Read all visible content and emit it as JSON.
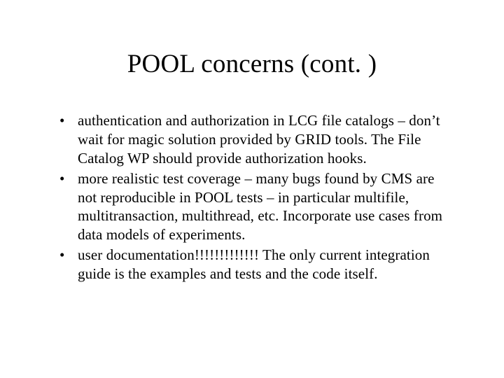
{
  "slide": {
    "title": "POOL concerns (cont. )",
    "bullets": [
      "authentication and authorization in LCG file catalogs – don’t wait for magic solution provided by GRID tools.  The File Catalog WP should provide authorization hooks.",
      "more realistic test coverage – many bugs found by CMS are not reproducible in POOL tests – in particular multifile, multitransaction, multithread, etc.   Incorporate use cases from data models of experiments.",
      "user documentation!!!!!!!!!!!!!   The only current integration guide is the examples and tests and the code itself."
    ]
  }
}
